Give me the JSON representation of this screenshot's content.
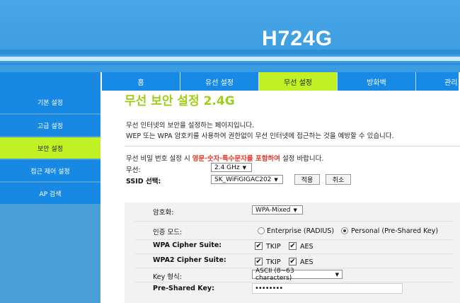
{
  "header": {
    "model": "H724G"
  },
  "topnav": {
    "tabs": [
      {
        "label": "홈"
      },
      {
        "label": "유선 설정"
      },
      {
        "label": "무선 설정"
      },
      {
        "label": "방화벽"
      },
      {
        "label": "관리"
      }
    ],
    "active_index": 2
  },
  "sidebar": {
    "items": [
      {
        "label": "기본 설정"
      },
      {
        "label": "고급 설정"
      },
      {
        "label": "보안 설정"
      },
      {
        "label": "접근 제어 설정"
      },
      {
        "label": "AP 검색"
      }
    ],
    "active_index": 2
  },
  "main": {
    "title": "무선 보안 설정 2.4G",
    "desc_line1": "무선 인터넷의 보안을 설정하는 페이지입니다.",
    "desc_line2": "WEP 또는 WPA 암호키를 사용하여 권한없이 무선 인터넷에 접근하는 것을 예방할 수 있습니다.",
    "hint_prefix": "무선 비밀 번호 설정 시 ",
    "hint_red": "영문·숫자·특수문자를 포함하여",
    "hint_suffix": " 설정 바랍니다.",
    "wireless_label": "무선:",
    "wireless_value": "2.4 GHz",
    "ssid_label": "SSID 선택:",
    "ssid_value": "SK_WiFiGIGAC202",
    "apply_button": "적용",
    "cancel_button": "취소"
  },
  "security": {
    "encryption_label": "암호화:",
    "encryption_value": "WPA-Mixed",
    "auth_label": "인증 모드:",
    "auth_option_enterprise": "Enterprise (RADIUS)",
    "auth_option_personal": "Personal (Pre-Shared Key)",
    "auth_selected": "personal",
    "wpa_cipher_label": "WPA Cipher Suite:",
    "wpa2_cipher_label": "WPA2 Cipher Suite:",
    "tkip_label": "TKIP",
    "aes_label": "AES",
    "check_mark": "✔",
    "key_format_label": "Key 형식:",
    "key_format_value": "ASCII (8~63 characters)",
    "psk_label": "Pre-Shared Key:",
    "psk_value": "••••••••"
  },
  "icons": {
    "dropdown_arrow": "▼"
  }
}
